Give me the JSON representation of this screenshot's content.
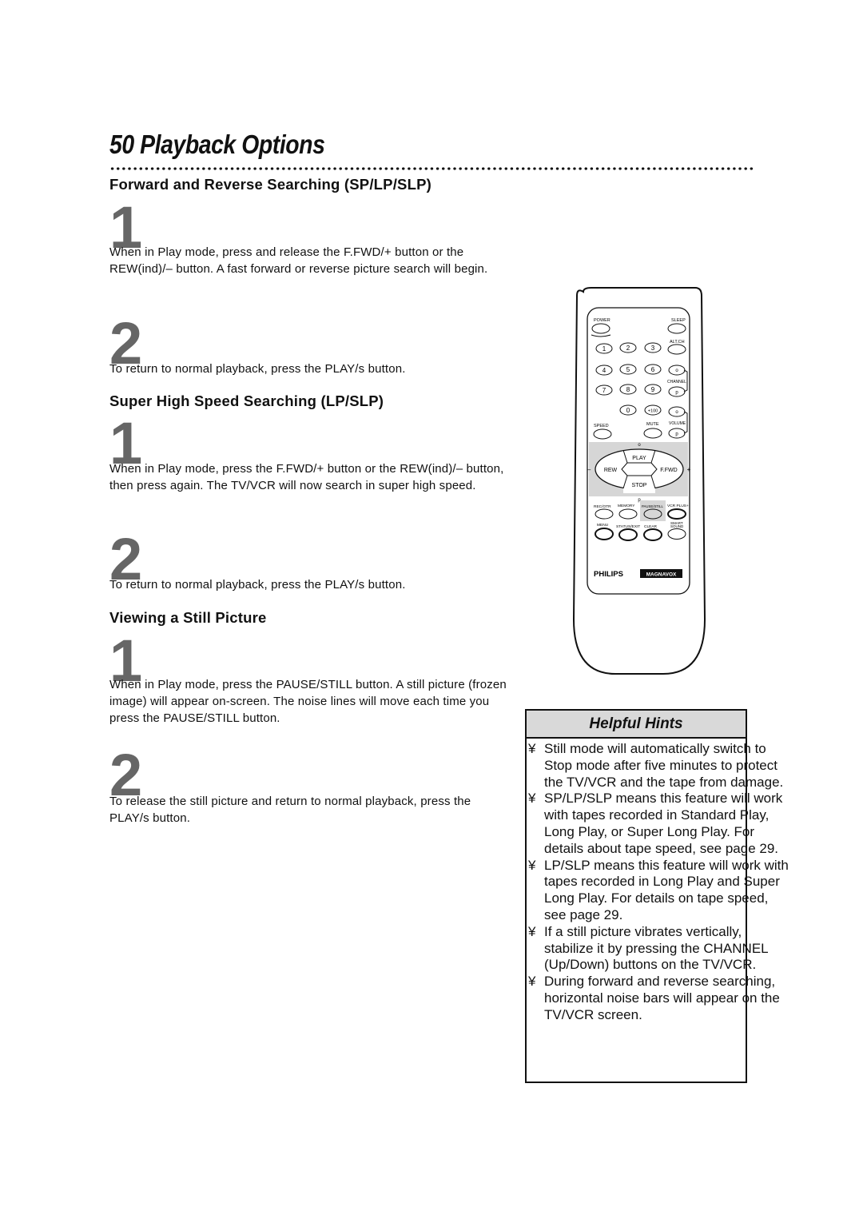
{
  "page": {
    "title": "50  Playback Options"
  },
  "sections": [
    {
      "heading": "Forward and Reverse Searching (SP/LP/SLP)",
      "steps": [
        {
          "number": "1",
          "text": "When in Play mode, press and release the F.FWD/+ button or the REW(ind)/– button. A fast forward or reverse picture search will begin."
        },
        {
          "number": "2",
          "text": "To return to normal playback, press the PLAY/s  button."
        }
      ]
    },
    {
      "heading": "Super High Speed Searching (LP/SLP)",
      "steps": [
        {
          "number": "1",
          "text": "When in Play mode, press the F.FWD/+ button or the REW(ind)/– button, then press again. The TV/VCR will now search in super high speed."
        },
        {
          "number": "2",
          "text": "To return to normal playback, press the PLAY/s  button."
        }
      ]
    },
    {
      "heading": "Viewing a Still Picture",
      "steps": [
        {
          "number": "1",
          "text": "When in Play mode, press the PAUSE/STILL button. A still picture (frozen image) will appear on-screen. The noise lines will move each time you press the PAUSE/STILL button."
        },
        {
          "number": "2",
          "text": "To release the still picture and return to normal playback, press the PLAY/s  button."
        }
      ]
    }
  ],
  "remote": {
    "labels": {
      "power": "POWER",
      "sleep": "SLEEP",
      "alt_ch": "ALT.CH",
      "channel": "CHANNEL",
      "volume": "VOLUME",
      "speed": "SPEED",
      "mute": "MUTE",
      "play": "PLAY",
      "stop": "STOP",
      "rew": "REW",
      "ffwd": "F.FWD",
      "minus": "–",
      "plus": "+",
      "up_arrow": "o",
      "down_arrow": "p",
      "rec_otr": "REC/OTR",
      "memory": "MEMORY",
      "pause_still": "PAUSE/STILL",
      "vcr_plus": "VCR PLUS+",
      "menu": "MENU",
      "status_exit": "STATUS/EXIT",
      "clear": "CLEAR",
      "smart_sound_1": "SMART",
      "smart_sound_2": "SOUND",
      "brand_philips": "PHILIPS",
      "brand_magnavox": "MAGNAVOX"
    },
    "number_keys": [
      "1",
      "2",
      "3",
      "4",
      "5",
      "6",
      "7",
      "8",
      "9",
      "0",
      "+100"
    ],
    "highlight_color": "#d6d6d6"
  },
  "helpful_hints": {
    "title": "Helpful Hints",
    "bullet": "¥",
    "items": [
      "Still mode will automatically switch to Stop mode after five minutes to protect the TV/VCR and the tape from damage.",
      "SP/LP/SLP means this feature will work with tapes recorded in Standard Play, Long Play, or Super Long Play.  For details about tape speed, see page 29.",
      "LP/SLP means this feature will work with tapes recorded in Long Play and Super Long Play.  For details on tape speed, see page 29.",
      "If a still picture vibrates vertically, stabilize it by pressing the CHANNEL  (Up/Down) buttons on the TV/VCR.",
      "During forward and reverse searching, horizontal noise bars will appear on the TV/VCR screen."
    ]
  }
}
